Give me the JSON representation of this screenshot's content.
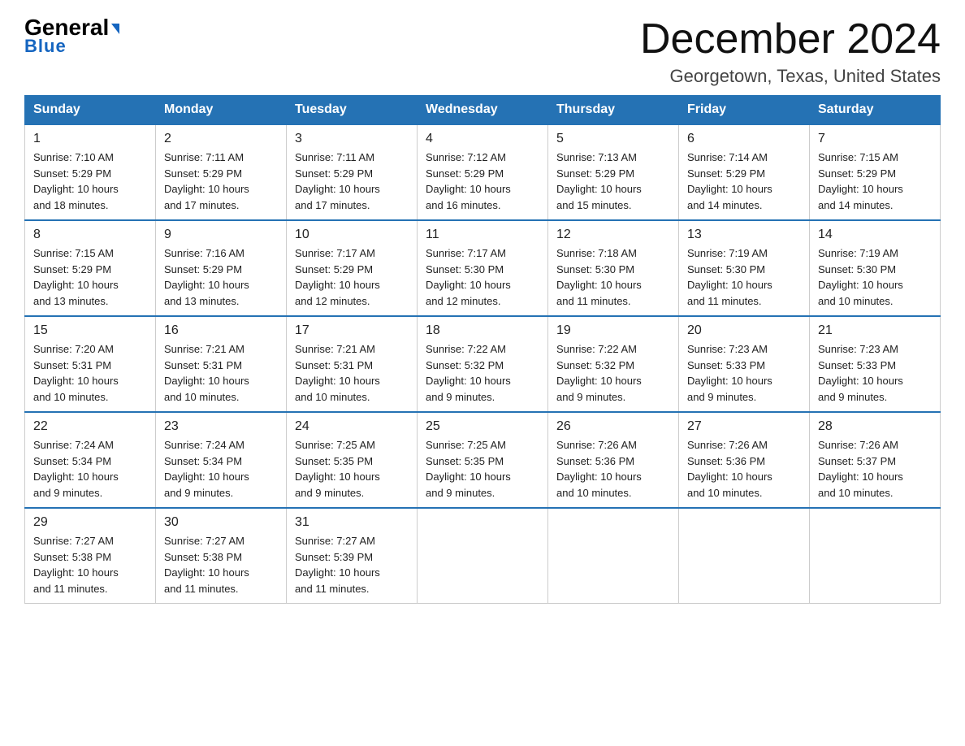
{
  "header": {
    "logo_general": "General",
    "logo_blue": "Blue",
    "title": "December 2024",
    "subtitle": "Georgetown, Texas, United States"
  },
  "days_of_week": [
    "Sunday",
    "Monday",
    "Tuesday",
    "Wednesday",
    "Thursday",
    "Friday",
    "Saturday"
  ],
  "weeks": [
    [
      {
        "day": "1",
        "sunrise": "7:10 AM",
        "sunset": "5:29 PM",
        "daylight": "10 hours and 18 minutes."
      },
      {
        "day": "2",
        "sunrise": "7:11 AM",
        "sunset": "5:29 PM",
        "daylight": "10 hours and 17 minutes."
      },
      {
        "day": "3",
        "sunrise": "7:11 AM",
        "sunset": "5:29 PM",
        "daylight": "10 hours and 17 minutes."
      },
      {
        "day": "4",
        "sunrise": "7:12 AM",
        "sunset": "5:29 PM",
        "daylight": "10 hours and 16 minutes."
      },
      {
        "day": "5",
        "sunrise": "7:13 AM",
        "sunset": "5:29 PM",
        "daylight": "10 hours and 15 minutes."
      },
      {
        "day": "6",
        "sunrise": "7:14 AM",
        "sunset": "5:29 PM",
        "daylight": "10 hours and 14 minutes."
      },
      {
        "day": "7",
        "sunrise": "7:15 AM",
        "sunset": "5:29 PM",
        "daylight": "10 hours and 14 minutes."
      }
    ],
    [
      {
        "day": "8",
        "sunrise": "7:15 AM",
        "sunset": "5:29 PM",
        "daylight": "10 hours and 13 minutes."
      },
      {
        "day": "9",
        "sunrise": "7:16 AM",
        "sunset": "5:29 PM",
        "daylight": "10 hours and 13 minutes."
      },
      {
        "day": "10",
        "sunrise": "7:17 AM",
        "sunset": "5:29 PM",
        "daylight": "10 hours and 12 minutes."
      },
      {
        "day": "11",
        "sunrise": "7:17 AM",
        "sunset": "5:30 PM",
        "daylight": "10 hours and 12 minutes."
      },
      {
        "day": "12",
        "sunrise": "7:18 AM",
        "sunset": "5:30 PM",
        "daylight": "10 hours and 11 minutes."
      },
      {
        "day": "13",
        "sunrise": "7:19 AM",
        "sunset": "5:30 PM",
        "daylight": "10 hours and 11 minutes."
      },
      {
        "day": "14",
        "sunrise": "7:19 AM",
        "sunset": "5:30 PM",
        "daylight": "10 hours and 10 minutes."
      }
    ],
    [
      {
        "day": "15",
        "sunrise": "7:20 AM",
        "sunset": "5:31 PM",
        "daylight": "10 hours and 10 minutes."
      },
      {
        "day": "16",
        "sunrise": "7:21 AM",
        "sunset": "5:31 PM",
        "daylight": "10 hours and 10 minutes."
      },
      {
        "day": "17",
        "sunrise": "7:21 AM",
        "sunset": "5:31 PM",
        "daylight": "10 hours and 10 minutes."
      },
      {
        "day": "18",
        "sunrise": "7:22 AM",
        "sunset": "5:32 PM",
        "daylight": "10 hours and 9 minutes."
      },
      {
        "day": "19",
        "sunrise": "7:22 AM",
        "sunset": "5:32 PM",
        "daylight": "10 hours and 9 minutes."
      },
      {
        "day": "20",
        "sunrise": "7:23 AM",
        "sunset": "5:33 PM",
        "daylight": "10 hours and 9 minutes."
      },
      {
        "day": "21",
        "sunrise": "7:23 AM",
        "sunset": "5:33 PM",
        "daylight": "10 hours and 9 minutes."
      }
    ],
    [
      {
        "day": "22",
        "sunrise": "7:24 AM",
        "sunset": "5:34 PM",
        "daylight": "10 hours and 9 minutes."
      },
      {
        "day": "23",
        "sunrise": "7:24 AM",
        "sunset": "5:34 PM",
        "daylight": "10 hours and 9 minutes."
      },
      {
        "day": "24",
        "sunrise": "7:25 AM",
        "sunset": "5:35 PM",
        "daylight": "10 hours and 9 minutes."
      },
      {
        "day": "25",
        "sunrise": "7:25 AM",
        "sunset": "5:35 PM",
        "daylight": "10 hours and 9 minutes."
      },
      {
        "day": "26",
        "sunrise": "7:26 AM",
        "sunset": "5:36 PM",
        "daylight": "10 hours and 10 minutes."
      },
      {
        "day": "27",
        "sunrise": "7:26 AM",
        "sunset": "5:36 PM",
        "daylight": "10 hours and 10 minutes."
      },
      {
        "day": "28",
        "sunrise": "7:26 AM",
        "sunset": "5:37 PM",
        "daylight": "10 hours and 10 minutes."
      }
    ],
    [
      {
        "day": "29",
        "sunrise": "7:27 AM",
        "sunset": "5:38 PM",
        "daylight": "10 hours and 11 minutes."
      },
      {
        "day": "30",
        "sunrise": "7:27 AM",
        "sunset": "5:38 PM",
        "daylight": "10 hours and 11 minutes."
      },
      {
        "day": "31",
        "sunrise": "7:27 AM",
        "sunset": "5:39 PM",
        "daylight": "10 hours and 11 minutes."
      },
      null,
      null,
      null,
      null
    ]
  ],
  "labels": {
    "sunrise": "Sunrise:",
    "sunset": "Sunset:",
    "daylight": "Daylight:"
  }
}
